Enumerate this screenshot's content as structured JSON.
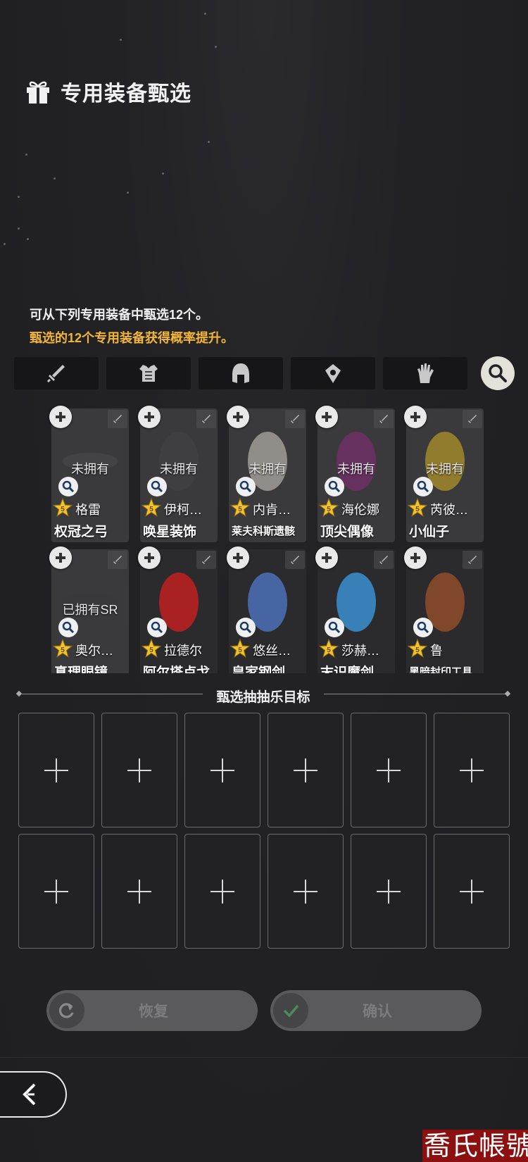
{
  "header": {
    "title": "专用装备甄选",
    "icon": "gift-icon"
  },
  "description": {
    "line1": "可从下列专用装备中甄选12个。",
    "line2": "甄选的12个专用装备获得概率提升。",
    "line2_color": "#f2b535"
  },
  "filters": [
    {
      "icon": "sword-icon"
    },
    {
      "icon": "armor-icon"
    },
    {
      "icon": "helmet-icon"
    },
    {
      "icon": "amulet-icon"
    },
    {
      "icon": "glove-icon"
    }
  ],
  "search_icon": "search-icon",
  "cards": [
    {
      "status": "未拥有",
      "hero": "格雷",
      "equip": "权冠之弓",
      "stars": 5
    },
    {
      "status": "未拥有",
      "hero": "伊柯…",
      "equip": "唤星装饰",
      "stars": 5
    },
    {
      "status": "未拥有",
      "hero": "内肯…",
      "equip": "莱夫科斯遗骸",
      "stars": 5
    },
    {
      "status": "未拥有",
      "hero": "海伦娜",
      "equip": "顶尖偶像",
      "stars": 5
    },
    {
      "status": "未拥有",
      "hero": "芮彼…",
      "equip": "小仙子",
      "stars": 5
    },
    {
      "status": "已拥有SR",
      "hero": "奥尔…",
      "equip": "真理眼镜",
      "stars": 5
    },
    {
      "status": "",
      "hero": "拉德尔",
      "equip": "阿尔塔卢戈",
      "stars": 5
    },
    {
      "status": "",
      "hero": "悠丝…",
      "equip": "皇家钢剑",
      "stars": 5
    },
    {
      "status": "",
      "hero": "莎赫…",
      "equip": "末识魔剑",
      "stars": 5
    },
    {
      "status": "",
      "hero": "鲁",
      "equip": "黑暗封印工具",
      "stars": 5
    }
  ],
  "target_section": {
    "label": "甄选抽抽乐目标",
    "slot_count": 12
  },
  "buttons": {
    "reset": "恢复",
    "confirm": "确认"
  },
  "watermark": "喬氏帳號"
}
